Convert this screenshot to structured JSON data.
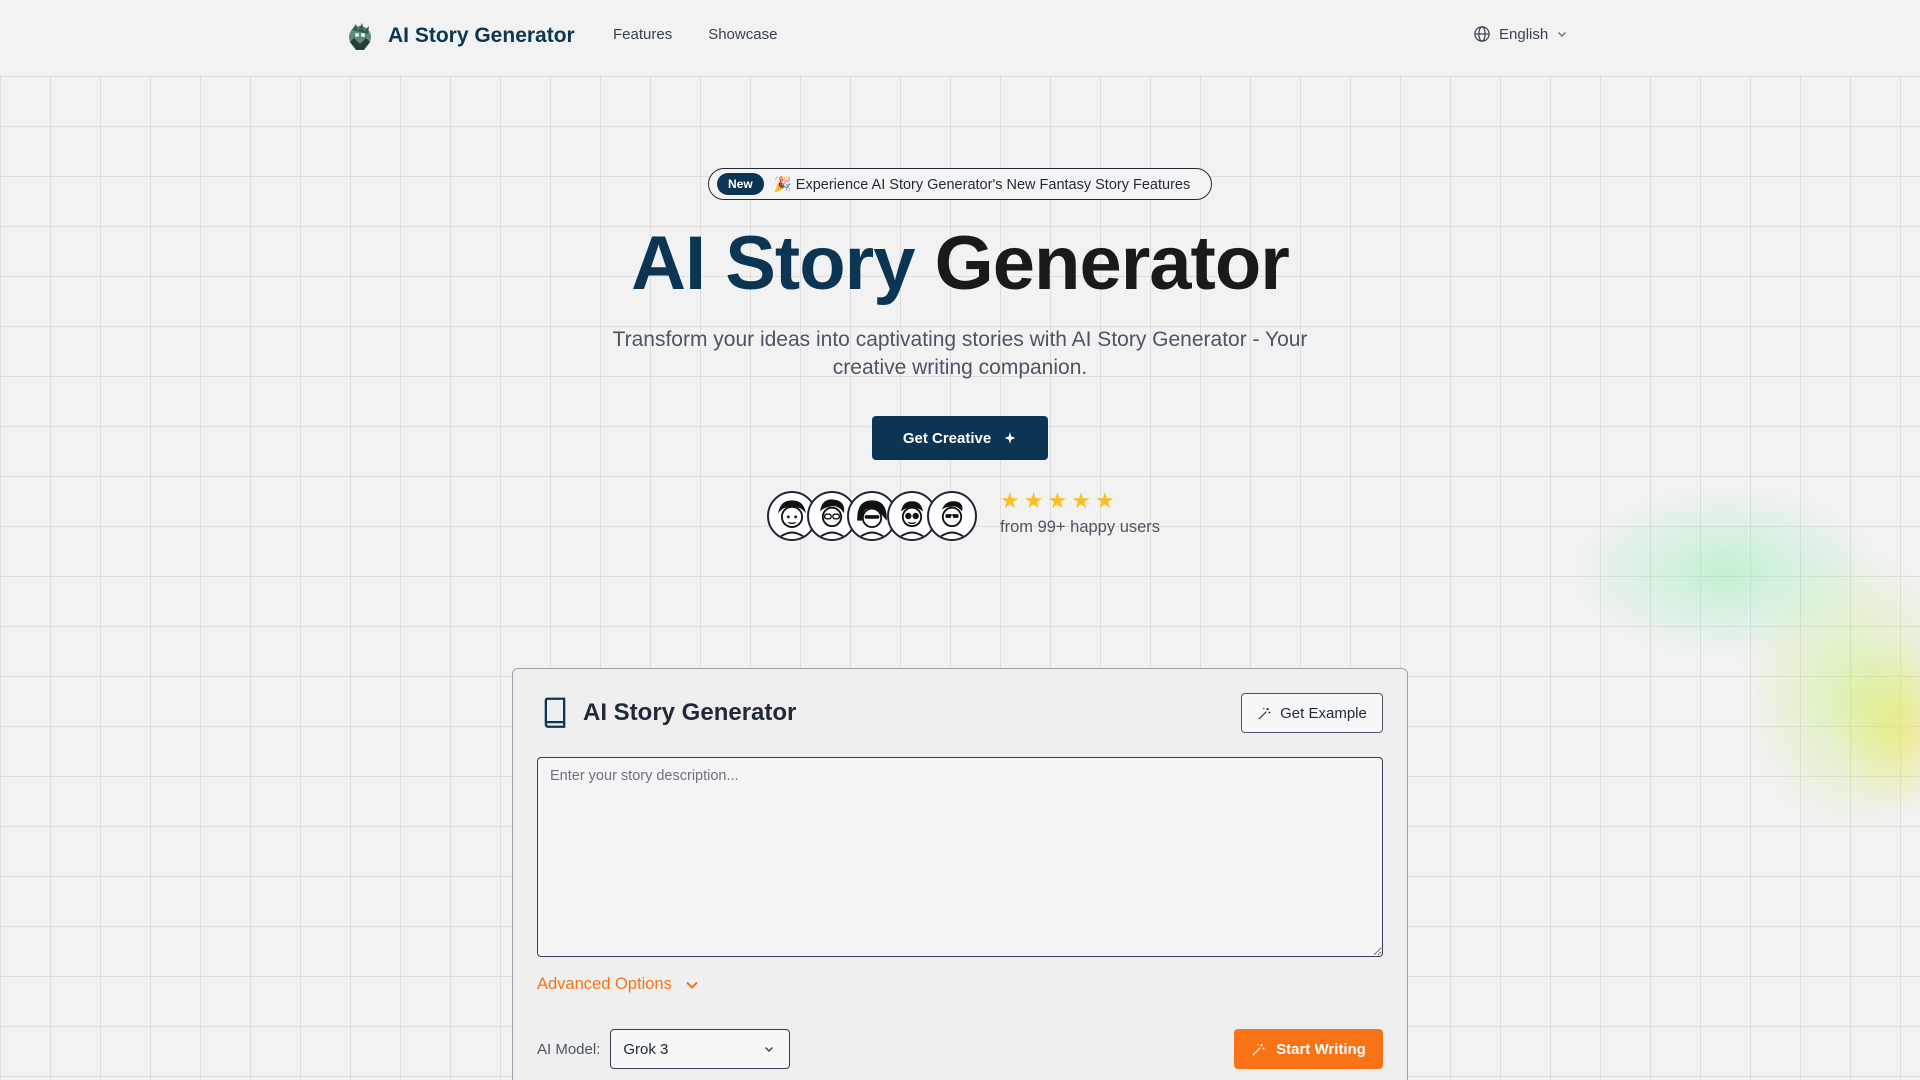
{
  "header": {
    "logo_text": "AI Story Generator",
    "nav": [
      {
        "label": "Features"
      },
      {
        "label": "Showcase"
      }
    ],
    "language": "English"
  },
  "hero": {
    "badge_new": "New",
    "badge_emoji": "🎉",
    "badge_text": "Experience AI Story Generator's New Fantasy Story Features",
    "title_accent": "AI Story",
    "title_rest": "Generator",
    "subtitle": "Transform your ideas into captivating stories with AI Story Generator - Your creative writing companion.",
    "cta_label": "Get Creative",
    "rating_stars": 5,
    "rating_text": "from 99+ happy users"
  },
  "generator": {
    "title": "AI Story Generator",
    "example_button": "Get Example",
    "input_placeholder": "Enter your story description...",
    "input_value": "",
    "advanced_label": "Advanced Options",
    "model_label": "AI Model:",
    "model_value": "Grok 3",
    "start_button": "Start Writing"
  },
  "colors": {
    "brand": "#0c3553",
    "accent": "#f97316",
    "star": "#fbbf24"
  }
}
